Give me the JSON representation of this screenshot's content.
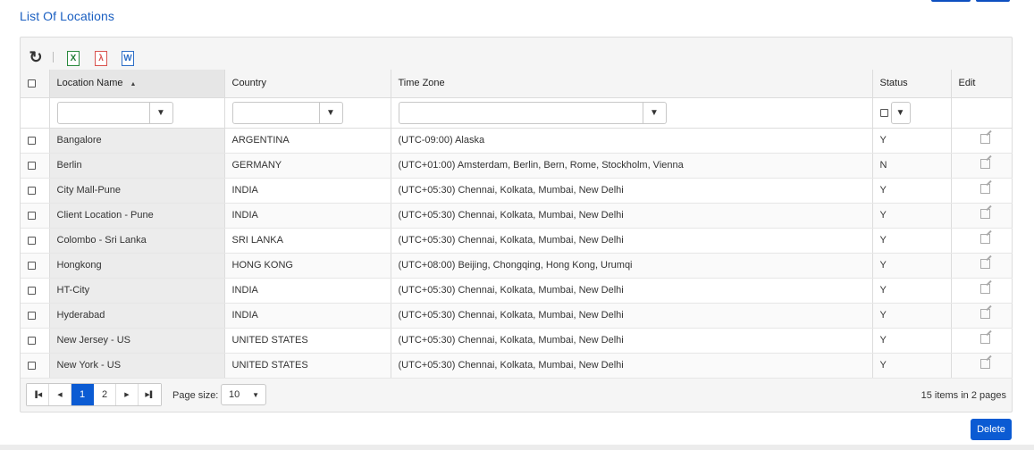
{
  "page": {
    "title": "List Of Locations"
  },
  "toolbar": {
    "refresh_icon": "refresh-icon",
    "export_excel_icon": "excel-icon",
    "export_pdf_icon": "pdf-icon",
    "export_word_icon": "word-icon",
    "excel_glyph": "X",
    "pdf_glyph": "λ",
    "word_glyph": "W"
  },
  "table": {
    "headers": {
      "location_name": "Location Name",
      "country": "Country",
      "time_zone": "Time Zone",
      "status": "Status",
      "edit": "Edit"
    },
    "sort_indicator": "▲",
    "rows": [
      {
        "name": "Bangalore",
        "country": "ARGENTINA",
        "timezone": "(UTC-09:00) Alaska",
        "status": "Y"
      },
      {
        "name": "Berlin",
        "country": "GERMANY",
        "timezone": "(UTC+01:00) Amsterdam, Berlin, Bern, Rome, Stockholm, Vienna",
        "status": "N"
      },
      {
        "name": "City Mall-Pune",
        "country": "INDIA",
        "timezone": "(UTC+05:30) Chennai, Kolkata, Mumbai, New Delhi",
        "status": "Y"
      },
      {
        "name": "Client Location - Pune",
        "country": "INDIA",
        "timezone": "(UTC+05:30) Chennai, Kolkata, Mumbai, New Delhi",
        "status": "Y"
      },
      {
        "name": "Colombo - Sri Lanka",
        "country": "SRI LANKA",
        "timezone": "(UTC+05:30) Chennai, Kolkata, Mumbai, New Delhi",
        "status": "Y"
      },
      {
        "name": "Hongkong",
        "country": "HONG KONG",
        "timezone": "(UTC+08:00) Beijing, Chongqing, Hong Kong, Urumqi",
        "status": "Y"
      },
      {
        "name": "HT-City",
        "country": "INDIA",
        "timezone": "(UTC+05:30) Chennai, Kolkata, Mumbai, New Delhi",
        "status": "Y"
      },
      {
        "name": "Hyderabad",
        "country": "INDIA",
        "timezone": "(UTC+05:30) Chennai, Kolkata, Mumbai, New Delhi",
        "status": "Y"
      },
      {
        "name": "New Jersey - US",
        "country": "UNITED STATES",
        "timezone": "(UTC+05:30) Chennai, Kolkata, Mumbai, New Delhi",
        "status": "Y"
      },
      {
        "name": "New York - US",
        "country": "UNITED STATES",
        "timezone": "(UTC+05:30) Chennai, Kolkata, Mumbai, New Delhi",
        "status": "Y"
      }
    ]
  },
  "pager": {
    "first_glyph": "⏮",
    "prev_glyph": "◀",
    "next_glyph": "▶",
    "last_glyph": "⏭",
    "pages": [
      "1",
      "2"
    ],
    "active_page": "1",
    "page_size_label": "Page size:",
    "page_size_value": "10",
    "items_info": "15 items in 2 pages"
  },
  "actions": {
    "delete_label": "Delete"
  },
  "colors": {
    "accent": "#0b5bd3",
    "title": "#1a5fc1"
  }
}
